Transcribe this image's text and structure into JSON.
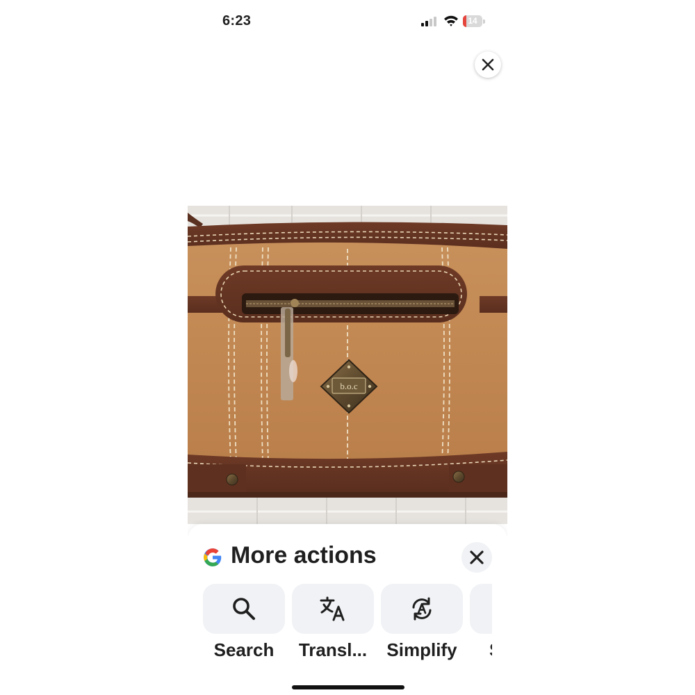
{
  "status_bar": {
    "time": "6:23",
    "battery_level": "14",
    "signal_icon": "cellular-signal-icon",
    "wifi_icon": "wifi-icon"
  },
  "image_viewer": {
    "close_icon": "close-icon",
    "logo_text": "b.o.c"
  },
  "more_actions": {
    "title": "More actions",
    "close_icon": "close-icon",
    "actions": [
      {
        "label": "Search",
        "icon": "search-icon"
      },
      {
        "label": "Transl...",
        "icon": "translate-icon"
      },
      {
        "label": "Simplify",
        "icon": "simplify-icon"
      },
      {
        "label": "S",
        "icon": ""
      }
    ]
  },
  "colors": {
    "google_blue": "#4285F4",
    "google_red": "#EA4335",
    "google_yellow": "#FBBC05",
    "google_green": "#34A853",
    "battery_low": "#E5453C"
  }
}
